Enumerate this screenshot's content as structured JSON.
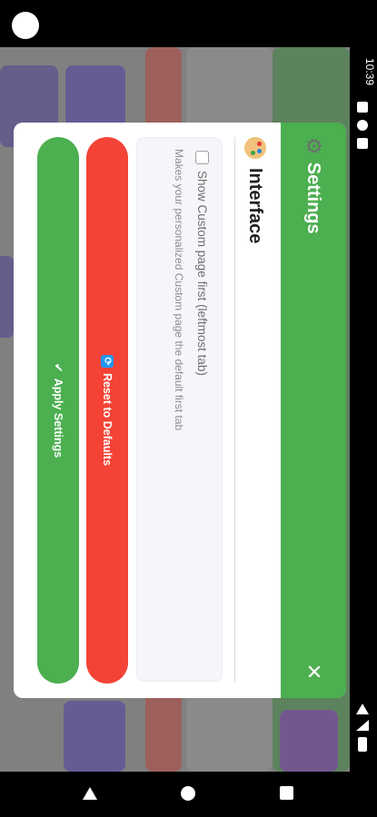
{
  "status_bar": {
    "time": "10:39"
  },
  "dialog": {
    "title": "Settings",
    "close_label": "✕",
    "section": {
      "title": "Interface"
    },
    "option": {
      "label": "Show Custom page first (leftmost tab)",
      "description": "Makes your personalized Custom page the default first tab",
      "checked": false
    },
    "buttons": {
      "reset_label": "Reset to Defaults",
      "apply_label": "Apply Settings"
    }
  },
  "colors": {
    "header": "#4caf50",
    "reset": "#f44336",
    "apply": "#4caf50"
  },
  "icons": [
    "gear-icon",
    "palette-icon",
    "close-icon",
    "refresh-icon",
    "check-icon",
    "back-icon",
    "home-icon",
    "recents-icon"
  ]
}
